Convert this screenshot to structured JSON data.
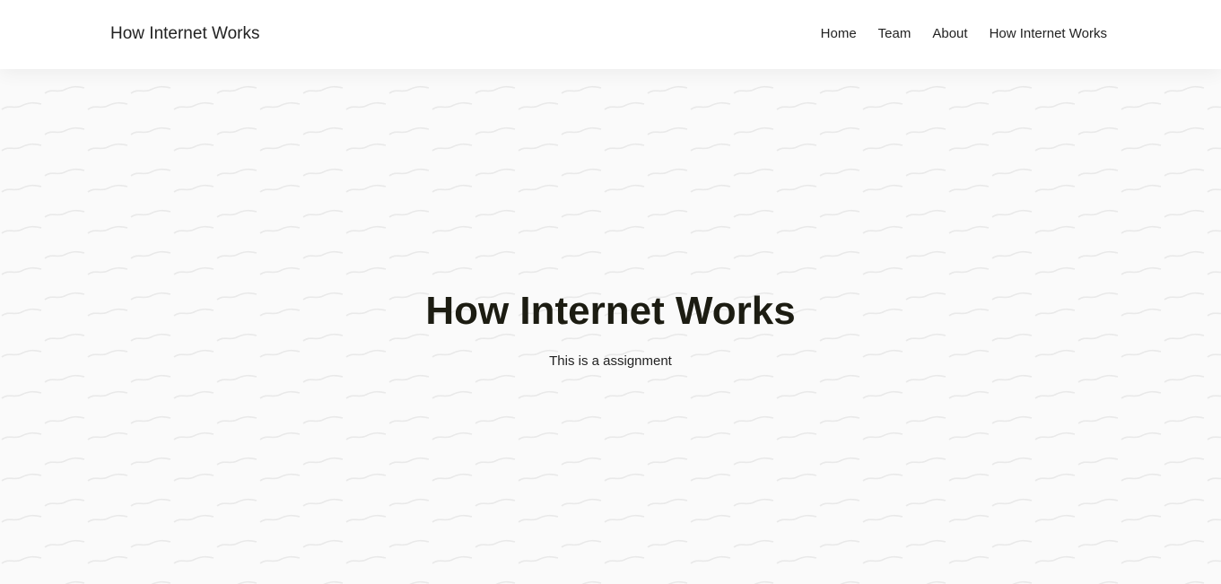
{
  "navbar": {
    "brand": "How Internet Works",
    "links": [
      {
        "label": "Home"
      },
      {
        "label": "Team"
      },
      {
        "label": "About"
      },
      {
        "label": "How Internet Works"
      }
    ]
  },
  "hero": {
    "title": "How Internet Works",
    "subtitle": "This is a assignment"
  }
}
